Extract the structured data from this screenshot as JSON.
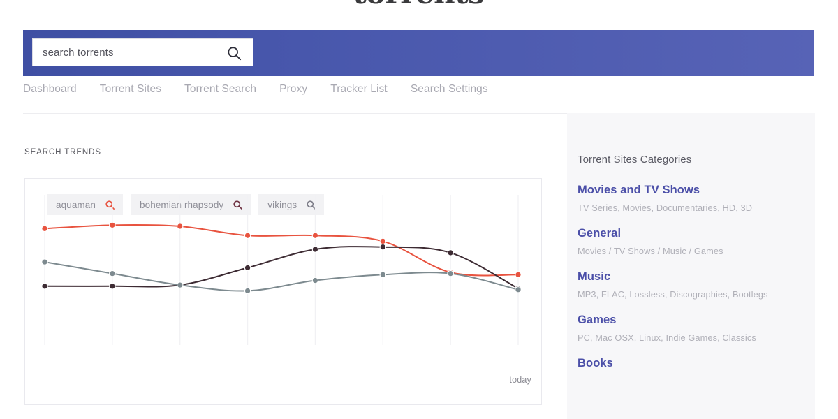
{
  "brand": {
    "logo_text": "torrents",
    "logo_lead": "˙",
    "logo_tail": "˙"
  },
  "search": {
    "placeholder": "search torrents",
    "value": "",
    "icon": "search-icon"
  },
  "nav": {
    "items": [
      {
        "label": "Dashboard"
      },
      {
        "label": "Torrent Sites"
      },
      {
        "label": "Torrent Search"
      },
      {
        "label": "Proxy"
      },
      {
        "label": "Tracker List"
      },
      {
        "label": "Search Settings"
      }
    ]
  },
  "trends": {
    "section_label": "SEARCH TRENDS",
    "today_label": "today",
    "pills": [
      {
        "label": "aquaman",
        "icon": "search-icon",
        "color": "#e8533f"
      },
      {
        "label": "bohemian rhapsody",
        "icon": "search-icon",
        "color": "#6d3040"
      },
      {
        "label": "vikings",
        "icon": "search-icon",
        "color": "#7d7d88"
      }
    ]
  },
  "chart_data": {
    "type": "line",
    "title": "SEARCH TRENDS",
    "xlabel": "",
    "ylabel": "",
    "grid": true,
    "legend": "top-left",
    "x": [
      0,
      1,
      2,
      3,
      4,
      5,
      6,
      7
    ],
    "x_tick_labels": [
      "",
      "",
      "",
      "",
      "",
      "",
      "",
      "today"
    ],
    "ylim": [
      0,
      100
    ],
    "annotations": [
      "today"
    ],
    "series": [
      {
        "name": "aquaman",
        "color": "#e8533f",
        "values": [
          78,
          81,
          80,
          72,
          72,
          67,
          40,
          38
        ]
      },
      {
        "name": "bohemian rhapsody",
        "color": "#3d2b33",
        "values": [
          28,
          28,
          29,
          44,
          60,
          62,
          57,
          26
        ]
      },
      {
        "name": "vikings",
        "color": "#7d8a8f",
        "values": [
          49,
          39,
          29,
          24,
          33,
          38,
          39,
          25
        ]
      }
    ]
  },
  "sidebar": {
    "heading": "Torrent Sites Categories",
    "categories": [
      {
        "title": "Movies and TV Shows",
        "desc": "TV Series, Movies, Documentaries, HD, 3D"
      },
      {
        "title": "General",
        "desc": "Movies / TV Shows / Music / Games"
      },
      {
        "title": "Music",
        "desc": "MP3, FLAC, Lossless, Discographies, Bootlegs"
      },
      {
        "title": "Games",
        "desc": "PC, Mac OSX, Linux, Indie Games, Classics"
      },
      {
        "title": "Books",
        "desc": ""
      }
    ]
  },
  "colors": {
    "brand_blue": "#4857ac",
    "accent_link": "#4b4fa8",
    "series_1": "#e8533f",
    "series_2": "#3d2b33",
    "series_3": "#7d8a8f"
  }
}
